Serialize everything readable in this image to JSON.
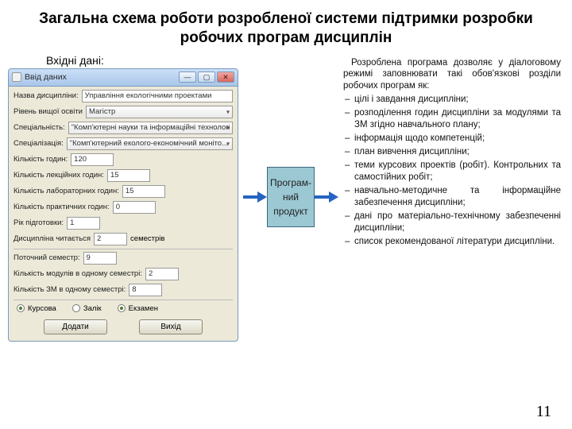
{
  "title": "Загальна схема роботи розробленої системи підтримки розробки робочих програм дисциплін",
  "input_label": "Вхідні дані:",
  "window": {
    "caption": "Ввід даних",
    "fields": {
      "disc_name_lbl": "Назва дисципліни:",
      "disc_name_val": "Управління екологічними проектами",
      "level_lbl": "Рівень вищої освіти",
      "level_val": "Магістр",
      "spec_lbl": "Спеціальність:",
      "spec_val": "\"Комп'ютерні науки та інформаційні технології\"",
      "specz_lbl": "Спеціалізація:",
      "specz_val": "\"Комп'ютерний еколого-економічний моніто...",
      "hours_lbl": "Кількість годин:",
      "hours_val": "120",
      "lect_lbl": "Кількість лекційних годин:",
      "lect_val": "15",
      "lab_lbl": "Кількість лабораторних годин:",
      "lab_val": "15",
      "pract_lbl": "Кількість практичних годин:",
      "pract_val": "0",
      "year_lbl": "Рік підготовки:",
      "year_val": "1",
      "read_lbl": "Дисципліна читається",
      "read_val": "2",
      "read_suffix": "семестрів",
      "cursem_lbl": "Поточний семестр:",
      "cursem_val": "9",
      "mods_lbl": "Кількість модулів в одному семестрі:",
      "mods_val": "2",
      "zm_lbl": "Кількість ЗМ в одному семестрі:",
      "zm_val": "8"
    },
    "radios": {
      "kursova": "Курсова",
      "zalik": "Залік",
      "ekzamen": "Екзамен"
    },
    "buttons": {
      "add": "Додати",
      "exit": "Вихід"
    }
  },
  "box_label": "Програм-\nний\nпродукт",
  "right": {
    "intro": "Розроблена програма дозволяє у діалоговому режимі заповнювати такі обов'язкові розділи робочих програм як:",
    "items": [
      "цілі і завдання дисципліни;",
      "розподілення годин дисципліни за модулями та ЗМ згідно навчального плану;",
      "інформація щодо компетенцій;",
      "план вивчення дисципліни;",
      "теми курсових проектів (робіт). Контрольних та самостійних робіт;",
      "навчально-методичне та інформаційне забезпечення дисципліни;",
      "дані про матеріально-технічному забезпеченні дисципліни;",
      "список рекомендованої літератури дисципліни."
    ]
  },
  "page_number": "11"
}
